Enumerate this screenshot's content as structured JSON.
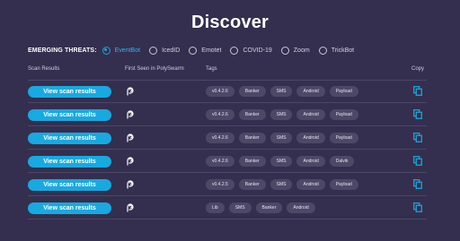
{
  "page": {
    "title": "Discover"
  },
  "threats": {
    "label": "EMERGING THREATS:",
    "options": [
      {
        "label": "EventBot",
        "selected": true
      },
      {
        "label": "IcedID",
        "selected": false
      },
      {
        "label": "Emotet",
        "selected": false
      },
      {
        "label": "COVID-19",
        "selected": false
      },
      {
        "label": "Zoom",
        "selected": false
      },
      {
        "label": "TrickBot",
        "selected": false
      }
    ]
  },
  "table": {
    "headers": {
      "scan_results": "Scan Results",
      "first_seen": "First Seen in PolySwarm",
      "tags": "Tags",
      "copy": "Copy"
    },
    "button_label": "View scan results",
    "rows": [
      {
        "tags": [
          "v0.4.2.6",
          "Banker",
          "SMS",
          "Android",
          "Payload"
        ]
      },
      {
        "tags": [
          "v0.4.2.6",
          "Banker",
          "SMS",
          "Android",
          "Payload"
        ]
      },
      {
        "tags": [
          "v0.4.2.6",
          "Banker",
          "SMS",
          "Android",
          "Payload"
        ]
      },
      {
        "tags": [
          "v0.4.2.6",
          "Banker",
          "SMS",
          "Android",
          "Dalvik"
        ]
      },
      {
        "tags": [
          "v0.4.2.5",
          "Banker",
          "SMS",
          "Android",
          "Payload"
        ]
      },
      {
        "tags": [
          "Lib",
          "SMS",
          "Banker",
          "Android"
        ]
      }
    ]
  },
  "icons": {
    "first_seen": "polyswarm-logo-icon",
    "copy": "copy-icon"
  },
  "colors": {
    "background": "#342f4f",
    "accent": "#18a9e0",
    "tag_bg": "#4d4867"
  }
}
